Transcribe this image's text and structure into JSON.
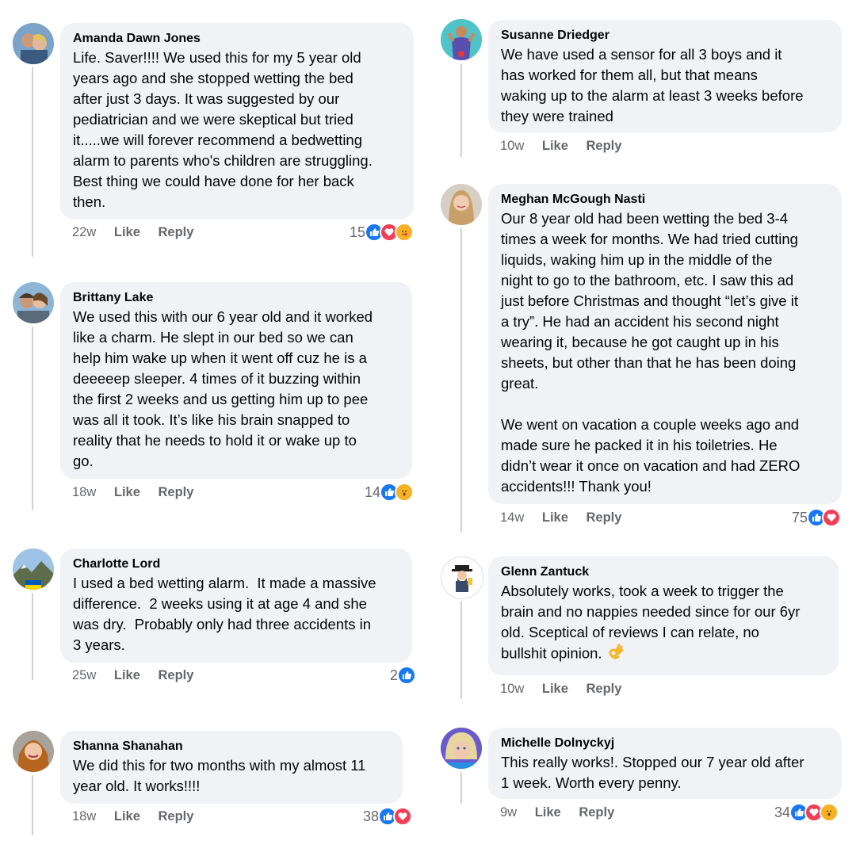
{
  "colors": {
    "like": "#1877f2",
    "love": "#f33e58",
    "wow": "#f7b125",
    "bubble": "#f0f2f5",
    "meta": "#65676b"
  },
  "comments": [
    {
      "author": "Amanda Dawn Jones",
      "text": "Life. Saver!!!! We used this for my 5 year old\nyears ago and she stopped wetting the bed\nafter just 3 days. It was suggested by our\npediatrician and we were skeptical but tried\nit.....we will forever recommend a bedwetting\nalarm to parents who's children are struggling.\nBest thing we could have done for her back\nthen.",
      "time": "22w",
      "like": "Like",
      "reply": "Reply",
      "reaction_count": "15",
      "reactions": [
        "like-icon",
        "love-icon",
        "care-icon"
      ]
    },
    {
      "author": "Brittany Lake",
      "text": "We used this with our 6 year old and it worked\nlike a charm. He slept in our bed so we can\nhelp him wake up when it went off cuz he is a\ndeeeeep sleeper. 4 times of it buzzing within\nthe first 2 weeks and us getting him up to pee\nwas all it took. It’s like his brain snapped to\nreality that he needs to hold it or wake up to\ngo.",
      "time": "18w",
      "like": "Like",
      "reply": "Reply",
      "reaction_count": "14",
      "reactions": [
        "like-icon",
        "wow-icon"
      ]
    },
    {
      "author": "Charlotte Lord",
      "text": "I used a bed wetting alarm.  It made a massive\ndifference.  2 weeks using it at age 4 and she\nwas dry.  Probably only had three accidents in\n3 years.",
      "time": "25w",
      "like": "Like",
      "reply": "Reply",
      "reaction_count": "2",
      "reactions": [
        "like-icon"
      ]
    },
    {
      "author": "Shanna Shanahan",
      "text": "We did this for two months with my almost 11\nyear old. It works!!!!",
      "time": "18w",
      "like": "Like",
      "reply": "Reply",
      "reaction_count": "38",
      "reactions": [
        "like-icon",
        "love-icon"
      ]
    },
    {
      "author": "Susanne Driedger",
      "text": "We have used a sensor for all 3 boys and it\nhas worked for them all, but that means\nwaking up to the alarm at least 3 weeks before\nthey were trained",
      "time": "10w",
      "like": "Like",
      "reply": "Reply",
      "reaction_count": "",
      "reactions": []
    },
    {
      "author": "Meghan McGough Nasti",
      "text": "Our 8 year old had been wetting the bed 3-4\ntimes a week for months. We had tried cutting\nliquids, waking him up in the middle of the\nnight to go to the bathroom, etc. I saw this ad\njust before Christmas and thought “let’s give it\na try”. He had an accident his second night\nwearing it, because he got caught up in his\nsheets, but other than that he has been doing\ngreat.\n\nWe went on vacation a couple weeks ago and\nmade sure he packed it in his toiletries. He\ndidn’t wear it once on vacation and had ZERO\naccidents!!! Thank you!",
      "time": "14w",
      "like": "Like",
      "reply": "Reply",
      "reaction_count": "75",
      "reactions": [
        "like-icon",
        "love-icon"
      ]
    },
    {
      "author": "Glenn Zantuck",
      "text": "Absolutely works, took a week to trigger the\nbrain and no nappies needed since for our 6yr\nold. Sceptical of reviews I can relate, no\nbullshit opinion.",
      "emoji": "ok-hand-icon",
      "time": "10w",
      "like": "Like",
      "reply": "Reply",
      "reaction_count": "",
      "reactions": []
    },
    {
      "author": "Michelle Dolnyckyj",
      "text": "This really works!. Stopped our 7 year old after\n1 week. Worth every penny.",
      "time": "9w",
      "like": "Like",
      "reply": "Reply",
      "reaction_count": "34",
      "reactions": [
        "like-icon",
        "love-icon",
        "wow-icon"
      ]
    }
  ]
}
